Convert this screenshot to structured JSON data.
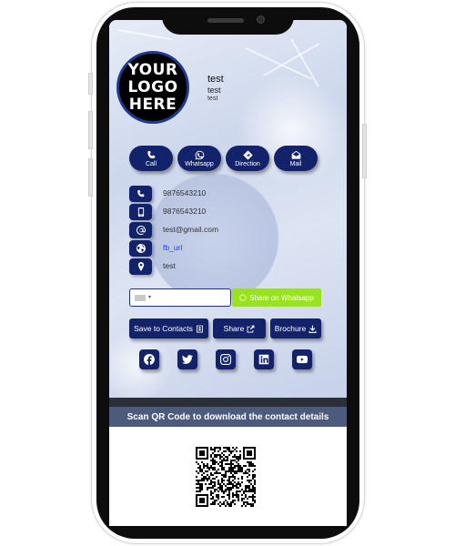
{
  "profile": {
    "logo_text": "YOUR LOGO HERE",
    "name": "test",
    "title": "test",
    "company": "test"
  },
  "actions": [
    {
      "label": "Call",
      "icon": "phone-icon"
    },
    {
      "label": "Whatsapp",
      "icon": "whatsapp-icon"
    },
    {
      "label": "Direction",
      "icon": "direction-icon"
    },
    {
      "label": "Mail",
      "icon": "mail-icon"
    }
  ],
  "contacts": [
    {
      "icon": "phone-icon",
      "value": "9876543210"
    },
    {
      "icon": "mobile-icon",
      "value": "9876543210"
    },
    {
      "icon": "email-icon",
      "value": "test@gmail.com"
    },
    {
      "icon": "globe-icon",
      "value": "fb_url"
    },
    {
      "icon": "location-pin-icon",
      "value": "test"
    }
  ],
  "share": {
    "whatsapp_label": "Share on Whatsapp",
    "save_contacts_label": "Save to Contacts",
    "share_label": "Share",
    "brochure_label": "Brochure"
  },
  "social": [
    "facebook-icon",
    "twitter-icon",
    "instagram-icon",
    "linkedin-icon",
    "youtube-icon"
  ],
  "qr": {
    "heading": "Scan QR Code to download the contact details"
  },
  "colors": {
    "primary": "#13236b",
    "whatsapp_green": "#99e21e",
    "qr_band": "#4c5a7c",
    "link": "#2a3fe0"
  }
}
